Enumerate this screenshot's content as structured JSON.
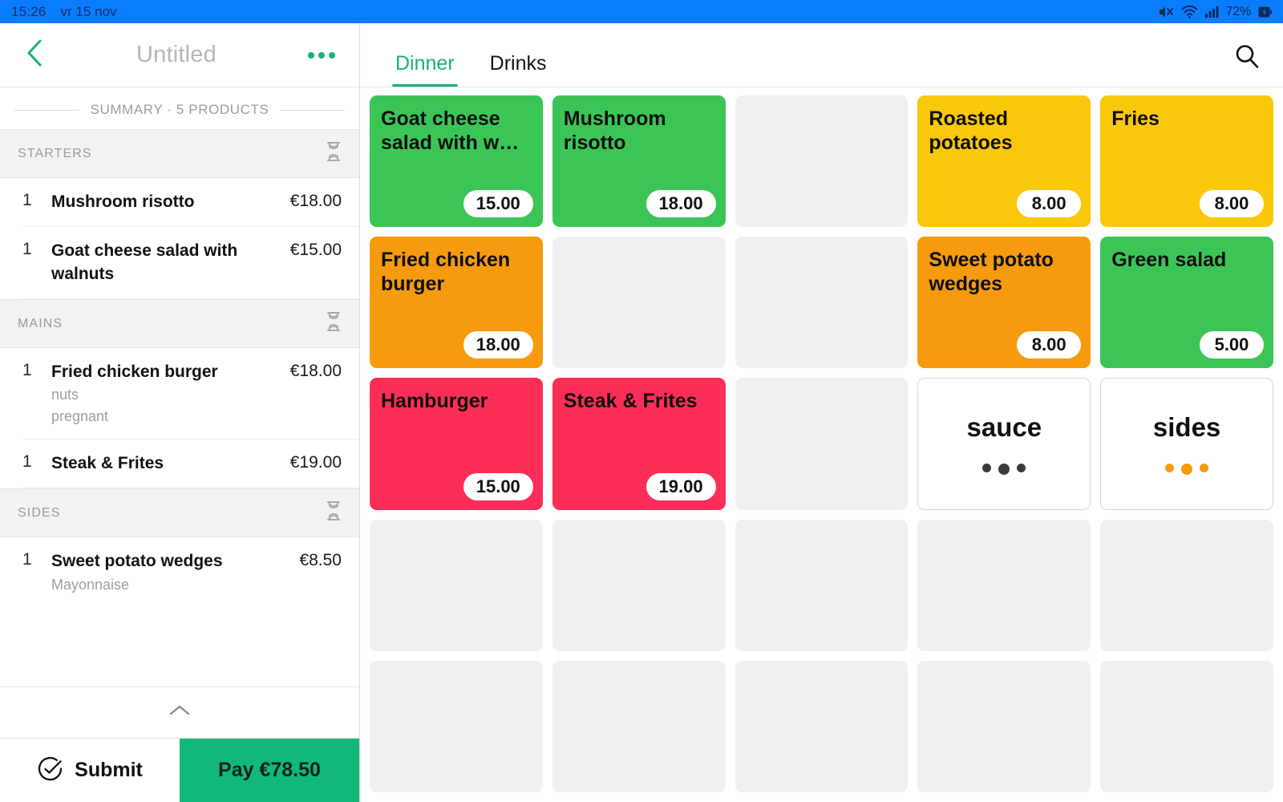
{
  "statusbar": {
    "time": "15:26",
    "date": "vr 15 nov",
    "battery": "72%",
    "icons": [
      "mute-icon",
      "wifi-icon",
      "signal-icon",
      "battery-icon"
    ]
  },
  "order_panel": {
    "title": "Untitled",
    "back_icon": "chevron-left-icon",
    "more_icon": "more-options-icon",
    "summary_label": "SUMMARY · 5 PRODUCTS",
    "collapse_icon": "chevron-up-icon",
    "sections": [
      {
        "label": "STARTERS",
        "status_icon": "hourglass-icon",
        "items": [
          {
            "qty": "1",
            "name": "Mushroom risotto",
            "price": "€18.00",
            "modifiers": []
          },
          {
            "qty": "1",
            "name": "Goat cheese salad with walnuts",
            "price": "€15.00",
            "modifiers": []
          }
        ]
      },
      {
        "label": "MAINS",
        "status_icon": "hourglass-icon",
        "items": [
          {
            "qty": "1",
            "name": "Fried chicken burger",
            "price": "€18.00",
            "modifiers": [
              "nuts",
              "pregnant"
            ]
          },
          {
            "qty": "1",
            "name": "Steak & Frites",
            "price": "€19.00",
            "modifiers": []
          }
        ]
      },
      {
        "label": "SIDES",
        "status_icon": "hourglass-icon",
        "items": [
          {
            "qty": "1",
            "name": "Sweet potato wedges",
            "price": "€8.50",
            "modifiers": [
              "Mayonnaise"
            ]
          }
        ]
      }
    ],
    "submit_label": "Submit",
    "submit_icon": "check-circle-icon",
    "pay_label": "Pay €78.50"
  },
  "catalog": {
    "tabs": [
      {
        "label": "Dinner",
        "active": true
      },
      {
        "label": "Drinks",
        "active": false
      }
    ],
    "search_icon": "search-icon",
    "grid_columns": 5,
    "grid_rows": 5,
    "tiles": [
      {
        "type": "product",
        "name": "Goat cheese salad with w…",
        "price": "15.00",
        "color": "#3cc557"
      },
      {
        "type": "product",
        "name": "Mushroom risotto",
        "price": "18.00",
        "color": "#3cc557"
      },
      {
        "type": "empty"
      },
      {
        "type": "product",
        "name": "Roasted potatoes",
        "price": "8.00",
        "color": "#f9c80b"
      },
      {
        "type": "product",
        "name": "Fries",
        "price": "8.00",
        "color": "#f9c80b"
      },
      {
        "type": "product",
        "name": "Fried chicken burger",
        "price": "18.00",
        "color": "#f79a0e"
      },
      {
        "type": "empty"
      },
      {
        "type": "empty"
      },
      {
        "type": "product",
        "name": "Sweet potato wedges",
        "price": "8.00",
        "color": "#f79a0e"
      },
      {
        "type": "product",
        "name": "Green salad",
        "price": "5.00",
        "color": "#3cc557"
      },
      {
        "type": "product",
        "name": "Hamburger",
        "price": "15.00",
        "color": "#fc2e57"
      },
      {
        "type": "product",
        "name": "Steak & Frites",
        "price": "19.00",
        "color": "#fc2e57"
      },
      {
        "type": "empty"
      },
      {
        "type": "category",
        "name": "sauce",
        "dot_color": "#3b3b3b"
      },
      {
        "type": "category",
        "name": "sides",
        "dot_color": "#f79a0e"
      },
      {
        "type": "empty"
      },
      {
        "type": "empty"
      },
      {
        "type": "empty"
      },
      {
        "type": "empty"
      },
      {
        "type": "empty"
      },
      {
        "type": "empty"
      },
      {
        "type": "empty"
      },
      {
        "type": "empty"
      },
      {
        "type": "empty"
      },
      {
        "type": "empty"
      }
    ]
  },
  "theme": {
    "accent_green": "#17b07d",
    "pay_green": "#12b87a",
    "statusbar_blue": "#0a7cff",
    "empty_tile": "#f0f0f3"
  }
}
